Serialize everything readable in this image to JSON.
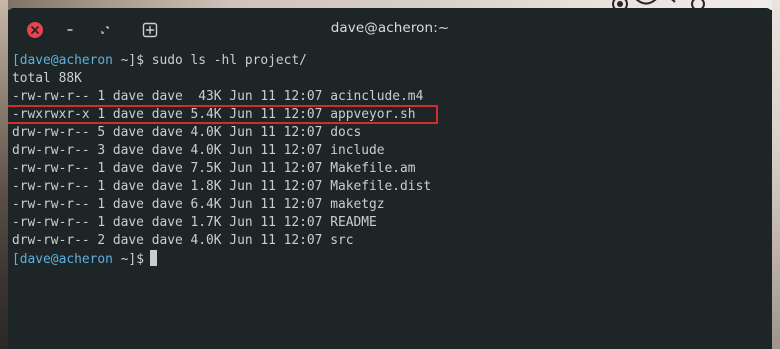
{
  "window": {
    "title": "dave@acheron:~"
  },
  "terminal": {
    "lines": [
      {
        "user": "[dave@acheron",
        "path": " ~]$",
        "cmd": " sudo ls -hl project/"
      },
      {
        "text": "total 88K"
      },
      {
        "text": "-rw-rw-r-- 1 dave dave  43K Jun 11 12:07 acinclude.m4"
      },
      {
        "text": "-rwxrwxr-x 1 dave dave 5.4K Jun 11 12:07 appveyor.sh"
      },
      {
        "text": "drw-rw-r-- 5 dave dave 4.0K Jun 11 12:07 docs"
      },
      {
        "text": "drw-rw-r-- 3 dave dave 4.0K Jun 11 12:07 include"
      },
      {
        "text": "-rw-rw-r-- 1 dave dave 7.5K Jun 11 12:07 Makefile.am"
      },
      {
        "text": "-rw-rw-r-- 1 dave dave 1.8K Jun 11 12:07 Makefile.dist"
      },
      {
        "text": "-rw-rw-r-- 1 dave dave 6.4K Jun 11 12:07 maketgz"
      },
      {
        "text": "-rw-rw-r-- 1 dave dave 1.7K Jun 11 12:07 README"
      },
      {
        "text": "drw-rw-r-- 2 dave dave 4.0K Jun 11 12:07 src"
      },
      {
        "user": "[dave@acheron",
        "path": " ~]$",
        "cmd": ""
      }
    ]
  },
  "colors": {
    "background": "#1d2526",
    "text": "#c9cfcf",
    "prompt": "#5fb0e0",
    "highlight_border": "#d42b2b",
    "close_button": "#e8434f"
  }
}
